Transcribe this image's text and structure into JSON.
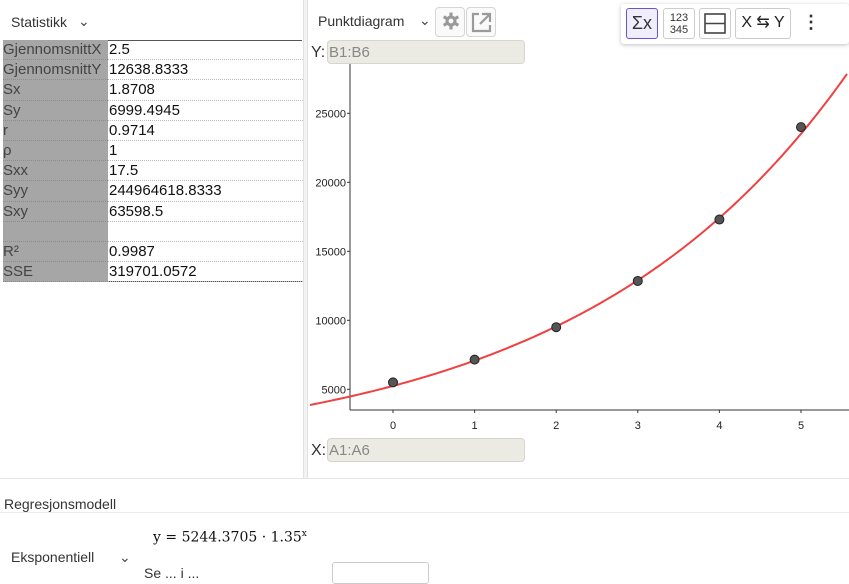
{
  "left_panel": {
    "dropdown_label": "Statistikk",
    "stats": [
      {
        "key": "GjennomsnittX",
        "value": "2.5"
      },
      {
        "key": "GjennomsnittY",
        "value": "12638.8333"
      },
      {
        "key": "Sx",
        "value": "1.8708"
      },
      {
        "key": "Sy",
        "value": "6999.4945"
      },
      {
        "key": "r",
        "value": "0.9714"
      },
      {
        "key": "ρ",
        "value": "1"
      },
      {
        "key": "Sxx",
        "value": "17.5"
      },
      {
        "key": "Syy",
        "value": "244964618.8333"
      },
      {
        "key": "Sxy",
        "value": "63598.5"
      },
      {
        "key": "",
        "value": ""
      },
      {
        "key": "R²",
        "value": "0.9987"
      },
      {
        "key": "SSE",
        "value": "319701.0572"
      }
    ]
  },
  "right_panel": {
    "plot_type": "Punktdiagram",
    "y_label": "Y:",
    "y_range": "B1:B6",
    "x_label": "X:",
    "x_range": "A1:A6",
    "toolbar": {
      "sum_label": "Σx",
      "numbers_line1": "123",
      "numbers_line2": "345",
      "swap_label": "X ⇆ Y",
      "more_label": "⋮"
    }
  },
  "regression": {
    "title": "Regresjonsmodell",
    "model": "Eksponentiell",
    "formula_lhs": "y",
    "formula_rhs": "5244.3705 · 1.35",
    "formula_exp": "x",
    "cut_text": "Se  ...  i   ..."
  },
  "chart_data": {
    "type": "scatter",
    "x": [
      0,
      1,
      2,
      3,
      4,
      5
    ],
    "y": [
      5500,
      7150,
      9500,
      12850,
      17300,
      24000
    ],
    "xlim": [
      -1,
      5.6
    ],
    "ylim": [
      3500,
      28500
    ],
    "x_ticks": [
      "0",
      "1",
      "2",
      "3",
      "4",
      "5"
    ],
    "y_ticks": [
      "5000",
      "10000",
      "15000",
      "20000",
      "25000"
    ],
    "y_tick_values": [
      5000,
      10000,
      15000,
      20000,
      25000
    ],
    "fit": {
      "a": 5244.3705,
      "b": 1.35
    },
    "point_color": "#555555",
    "fit_color": "#f04040",
    "grid": false
  }
}
